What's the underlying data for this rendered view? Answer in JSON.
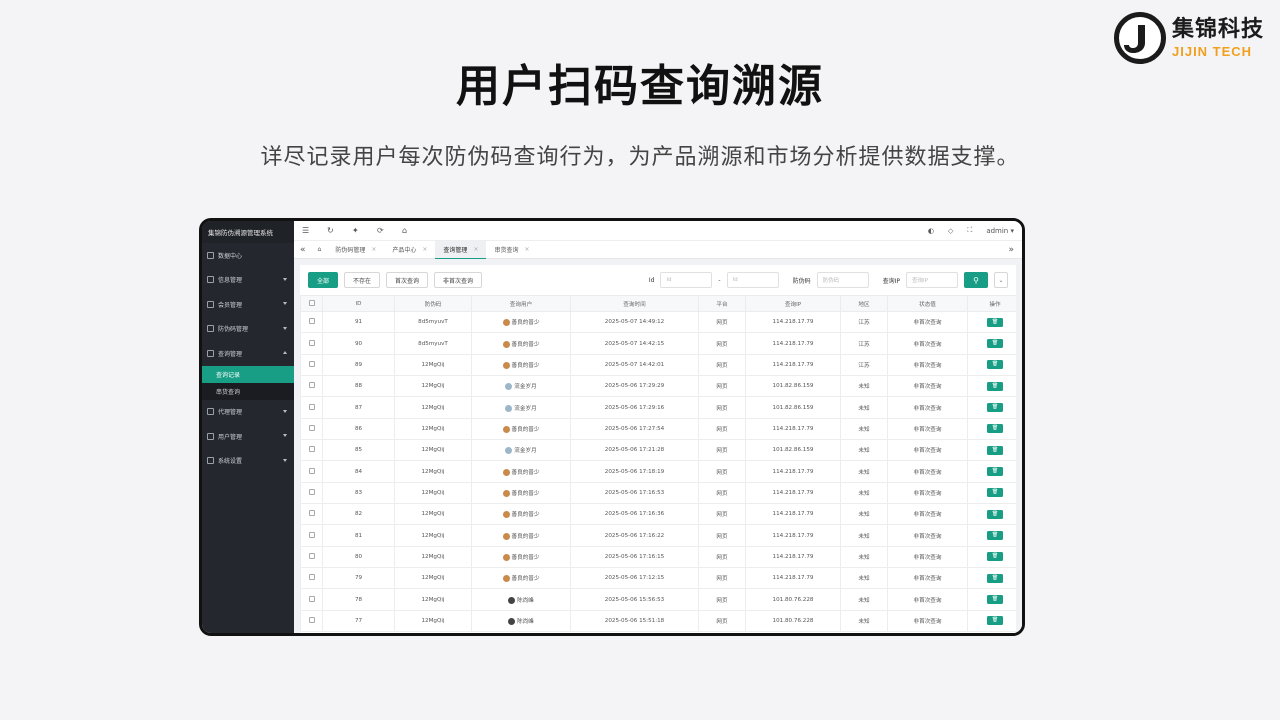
{
  "page": {
    "title": "用户扫码查询溯源",
    "subtitle": "详尽记录用户每次防伪码查询行为，为产品溯源和市场分析提供数据支撑。"
  },
  "logo": {
    "cn": "集锦科技",
    "en": "JIJIN TECH",
    "letter": "J",
    "accent": "#f0a01e"
  },
  "app": {
    "sidebar": {
      "title": "集锦防伪溯源管理系统",
      "items": [
        {
          "label": "数据中心",
          "icon": "dashboard-icon"
        },
        {
          "label": "信息管理",
          "icon": "info-icon"
        },
        {
          "label": "会员管理",
          "icon": "member-icon"
        },
        {
          "label": "防伪码管理",
          "icon": "code-icon"
        },
        {
          "label": "查询管理",
          "icon": "query-icon"
        },
        {
          "label": "代理管理",
          "icon": "agent-icon"
        },
        {
          "label": "用户管理",
          "icon": "user-icon"
        },
        {
          "label": "系统设置",
          "icon": "settings-icon"
        }
      ],
      "subitems": [
        {
          "label": "查询记录",
          "active": true
        },
        {
          "label": "串货查询",
          "active": false
        }
      ]
    },
    "topbar": {
      "user": "admin"
    },
    "tabs": [
      {
        "label": "防伪码管理"
      },
      {
        "label": "产品中心"
      },
      {
        "label": "查询管理",
        "active": true
      },
      {
        "label": "串货查询"
      }
    ],
    "filters": {
      "buttons": [
        "全部",
        "不存在",
        "首次查询",
        "非首次查询"
      ],
      "id_label": "Id",
      "id_from_placeholder": "Id",
      "id_sep": "-",
      "id_to_placeholder": "Id",
      "code_label": "防伪码",
      "code_placeholder": "防伪码",
      "ip_label": "查询IP",
      "ip_placeholder": "查询IP"
    },
    "table": {
      "columns": [
        "ID",
        "防伪码",
        "查询用户",
        "查询时间",
        "平台",
        "查询IP",
        "地区",
        "状态值",
        "操作"
      ],
      "rows": [
        {
          "id": "91",
          "code": "8d5myuvT",
          "user": "善良的普少",
          "time": "2025-05-07 14:49:12",
          "platform": "网页",
          "ip": "114.218.17.79",
          "region": "江苏",
          "status": "非首次查询",
          "avatar": "#c98a4b"
        },
        {
          "id": "90",
          "code": "8d5myuvT",
          "user": "善良的普少",
          "time": "2025-05-07 14:42:15",
          "platform": "网页",
          "ip": "114.218.17.79",
          "region": "江苏",
          "status": "非首次查询",
          "avatar": "#c98a4b"
        },
        {
          "id": "89",
          "code": "12MgQij",
          "user": "善良的普少",
          "time": "2025-05-07 14:42:01",
          "platform": "网页",
          "ip": "114.218.17.79",
          "region": "江苏",
          "status": "非首次查询",
          "avatar": "#c98a4b"
        },
        {
          "id": "88",
          "code": "12MgQij",
          "user": "流金岁月",
          "time": "2025-05-06 17:29:29",
          "platform": "网页",
          "ip": "101.82.86.159",
          "region": "未知",
          "status": "非首次查询",
          "avatar": "#9bb7c9"
        },
        {
          "id": "87",
          "code": "12MgQij",
          "user": "流金岁月",
          "time": "2025-05-06 17:29:16",
          "platform": "网页",
          "ip": "101.82.86.159",
          "region": "未知",
          "status": "非首次查询",
          "avatar": "#9bb7c9"
        },
        {
          "id": "86",
          "code": "12MgQij",
          "user": "善良的普少",
          "time": "2025-05-06 17:27:54",
          "platform": "网页",
          "ip": "114.218.17.79",
          "region": "未知",
          "status": "非首次查询",
          "avatar": "#c98a4b"
        },
        {
          "id": "85",
          "code": "12MgQij",
          "user": "流金岁月",
          "time": "2025-05-06 17:21:28",
          "platform": "网页",
          "ip": "101.82.86.159",
          "region": "未知",
          "status": "非首次查询",
          "avatar": "#9bb7c9"
        },
        {
          "id": "84",
          "code": "12MgQij",
          "user": "善良的普少",
          "time": "2025-05-06 17:18:19",
          "platform": "网页",
          "ip": "114.218.17.79",
          "region": "未知",
          "status": "非首次查询",
          "avatar": "#c98a4b"
        },
        {
          "id": "83",
          "code": "12MgQij",
          "user": "善良的普少",
          "time": "2025-05-06 17:16:53",
          "platform": "网页",
          "ip": "114.218.17.79",
          "region": "未知",
          "status": "非首次查询",
          "avatar": "#c98a4b"
        },
        {
          "id": "82",
          "code": "12MgQij",
          "user": "善良的普少",
          "time": "2025-05-06 17:16:36",
          "platform": "网页",
          "ip": "114.218.17.79",
          "region": "未知",
          "status": "非首次查询",
          "avatar": "#c98a4b"
        },
        {
          "id": "81",
          "code": "12MgQij",
          "user": "善良的普少",
          "time": "2025-05-06 17:16:22",
          "platform": "网页",
          "ip": "114.218.17.79",
          "region": "未知",
          "status": "非首次查询",
          "avatar": "#c98a4b"
        },
        {
          "id": "80",
          "code": "12MgQij",
          "user": "善良的普少",
          "time": "2025-05-06 17:16:15",
          "platform": "网页",
          "ip": "114.218.17.79",
          "region": "未知",
          "status": "非首次查询",
          "avatar": "#c98a4b"
        },
        {
          "id": "79",
          "code": "12MgQij",
          "user": "善良的普少",
          "time": "2025-05-06 17:12:15",
          "platform": "网页",
          "ip": "114.218.17.79",
          "region": "未知",
          "status": "非首次查询",
          "avatar": "#c98a4b"
        },
        {
          "id": "78",
          "code": "12MgQij",
          "user": "陈尚峰",
          "time": "2025-05-06 15:56:53",
          "platform": "网页",
          "ip": "101.80.76.228",
          "region": "未知",
          "status": "非首次查询",
          "avatar": "#444444"
        },
        {
          "id": "77",
          "code": "12MgQij",
          "user": "陈尚峰",
          "time": "2025-05-06 15:51:18",
          "platform": "网页",
          "ip": "101.80.76.228",
          "region": "未知",
          "status": "非首次查询",
          "avatar": "#444444"
        }
      ]
    },
    "colors": {
      "primary": "#179e84",
      "sidebar": "#24272e"
    }
  }
}
